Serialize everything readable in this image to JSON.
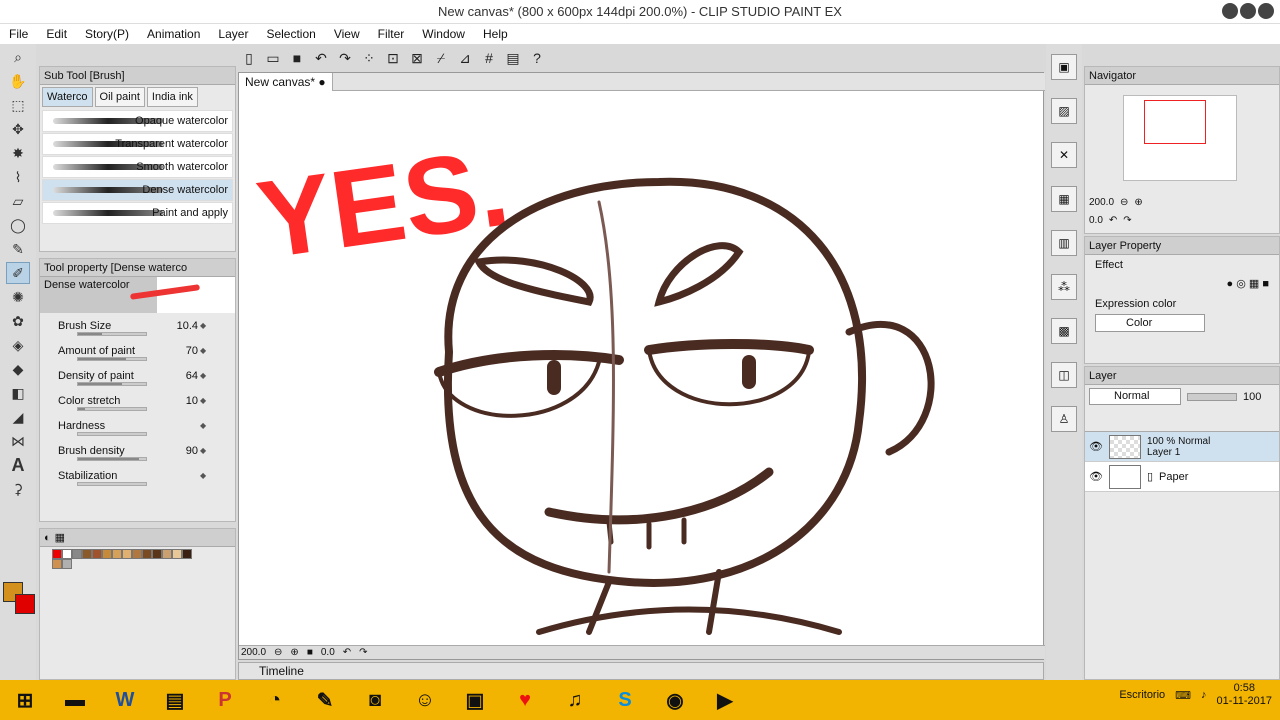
{
  "window": {
    "title": "New canvas* (800 x 600px 144dpi 200.0%) - CLIP STUDIO PAINT EX"
  },
  "menu": [
    "File",
    "Edit",
    "Story(P)",
    "Animation",
    "Layer",
    "Selection",
    "View",
    "Filter",
    "Window",
    "Help"
  ],
  "toolbar_icons": [
    "new-file-icon",
    "open-file-icon",
    "save-icon",
    "undo-icon",
    "redo-icon",
    "selection-icon",
    "transform-icon",
    "deselect-icon",
    "snap-icon",
    "ruler-icon",
    "grid-icon",
    "quick-access-icon",
    "help-icon"
  ],
  "subtool": {
    "header": "Sub Tool [Brush]",
    "tabs": [
      "Waterco",
      "Oil paint",
      "India ink"
    ],
    "brushes": [
      "Opaque watercolor",
      "Transparent watercolor",
      "Smooth watercolor",
      "Dense watercolor",
      "Paint and apply"
    ],
    "selected": "Dense watercolor"
  },
  "toolprop": {
    "header": "Tool property [Dense waterco",
    "preview_name": "Dense watercolor",
    "props": [
      {
        "label": "Brush Size",
        "value": "10.4",
        "level": 0.35
      },
      {
        "label": "Amount of paint",
        "value": "70",
        "level": 0.7
      },
      {
        "label": "Density of paint",
        "value": "64",
        "level": 0.64
      },
      {
        "label": "Color stretch",
        "value": "10",
        "level": 0.1
      },
      {
        "label": "Hardness",
        "value": "",
        "level": 0
      },
      {
        "label": "Brush density",
        "value": "90",
        "level": 0.9
      },
      {
        "label": "Stabilization",
        "value": "",
        "level": 0
      }
    ]
  },
  "canvas": {
    "tab_label": "New canvas*",
    "yes_text": "YES.",
    "zoom": "200.0",
    "rotation": "0.0"
  },
  "timeline": {
    "label": "Timeline"
  },
  "navigator": {
    "header": "Navigator",
    "zoom": "200.0",
    "rotation": "0.0"
  },
  "layer_property": {
    "header": "Layer Property",
    "effect_label": "Effect",
    "expression_label": "Expression color",
    "expression_value": "Color"
  },
  "layers": {
    "header": "Layer",
    "blend_mode": "Normal",
    "opacity": "100",
    "items": [
      {
        "line1": "100 %  Normal",
        "line2": "Layer 1"
      },
      {
        "line1": "",
        "line2": "Paper"
      }
    ]
  },
  "colors": {
    "main": "#d4901d",
    "sub": "#e00000",
    "accent": "#f2b400",
    "stroke": "#4a2b22",
    "yes_red": "#ff2a2a"
  },
  "taskbar": {
    "apps": [
      "windows-start",
      "stapler",
      "word",
      "file-explorer",
      "powerpoint",
      "corel",
      "paint",
      "clip-studio",
      "isaac",
      "notepad",
      "heart",
      "headphones",
      "skype",
      "chrome",
      "media-player"
    ],
    "tray_label": "Escritorio",
    "time": "0:58",
    "date": "01-11-2017"
  }
}
